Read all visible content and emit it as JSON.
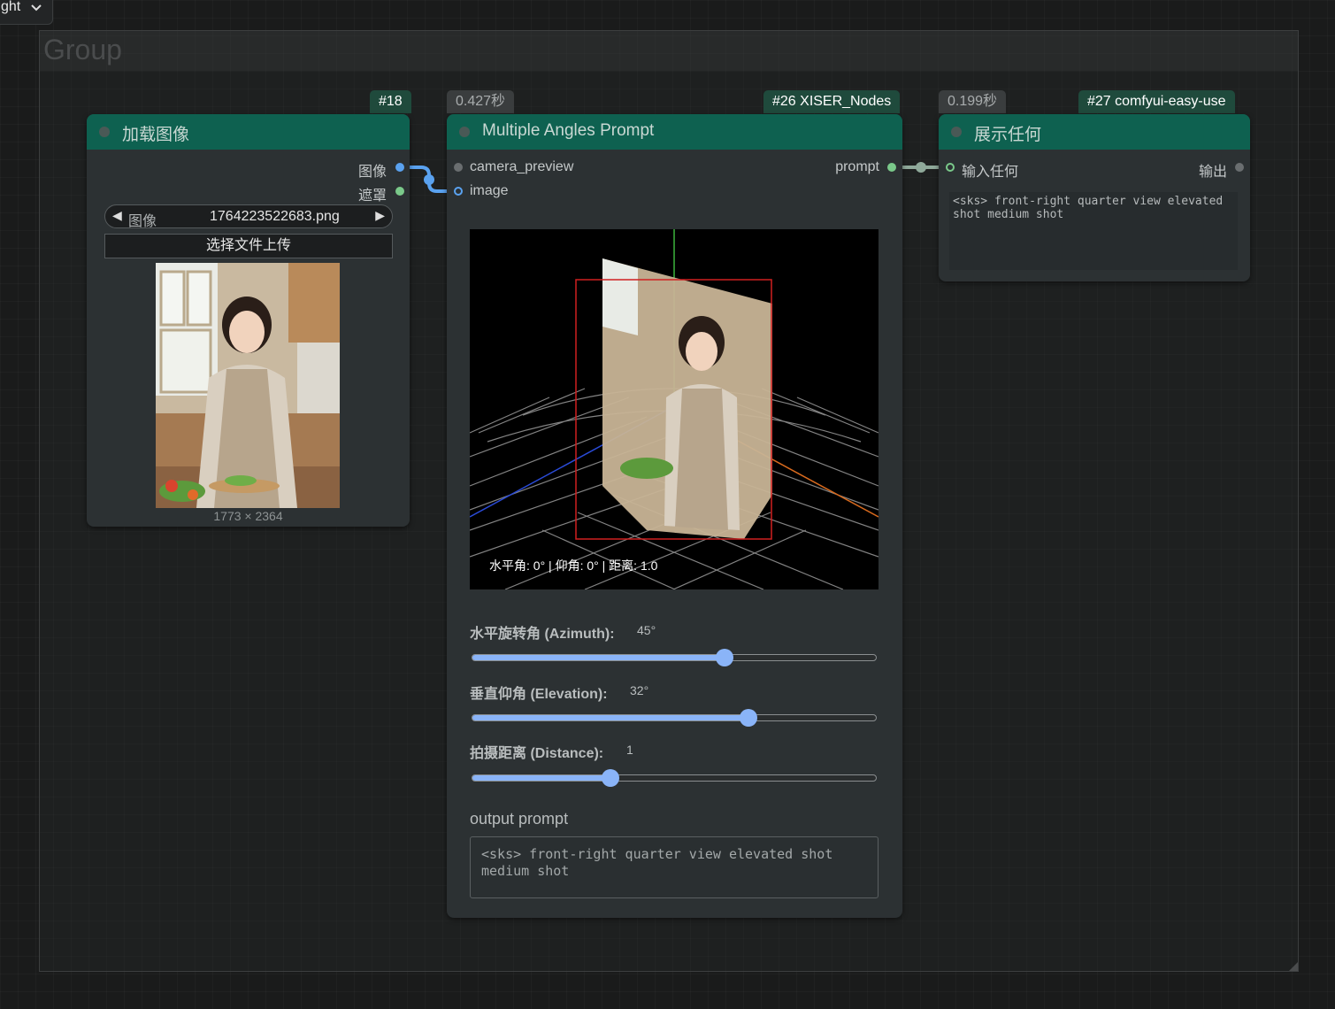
{
  "top_dropdown": {
    "label": "ght"
  },
  "group": {
    "title": "Group"
  },
  "nodes": {
    "load_image": {
      "id_badge": "#18",
      "title": "加载图像",
      "outputs": {
        "image": "图像",
        "mask": "遮罩"
      },
      "combo": {
        "label": "图像",
        "value": "1764223522683.png"
      },
      "upload_label": "选择文件上传",
      "dims": "1773 × 2364"
    },
    "multi_angles": {
      "time_badge": "0.427秒",
      "id_badge": "#26 XISER_Nodes",
      "title": "Multiple Angles Prompt",
      "inputs": {
        "camera_preview": "camera_preview",
        "image": "image"
      },
      "output": "prompt",
      "preview_text": "水平角: 0° | 仰角: 0° | 距离: 1.0",
      "sliders": {
        "azimuth": {
          "label": "水平旋转角 (Azimuth):",
          "value_text": "45°",
          "fraction": 0.624
        },
        "elevation": {
          "label": "垂直仰角 (Elevation):",
          "value_text": "32°",
          "fraction": 0.684
        },
        "distance": {
          "label": "拍摄距离 (Distance):",
          "value_text": "1",
          "fraction": 0.343
        }
      },
      "output_label": "output prompt",
      "output_text": "<sks> front-right quarter view elevated shot medium shot"
    },
    "show_any": {
      "time_badge": "0.199秒",
      "id_badge": "#27 comfyui-easy-use",
      "title": "展示任何",
      "input": "输入任何",
      "output": "输出",
      "text": "<sks> front-right quarter view elevated shot medium shot"
    }
  },
  "colors": {
    "node_header": "#0e6150",
    "link_image": "#5aa2f0",
    "link_prompt": "#8fa99a",
    "slider_fill": "#8ab4f8"
  }
}
